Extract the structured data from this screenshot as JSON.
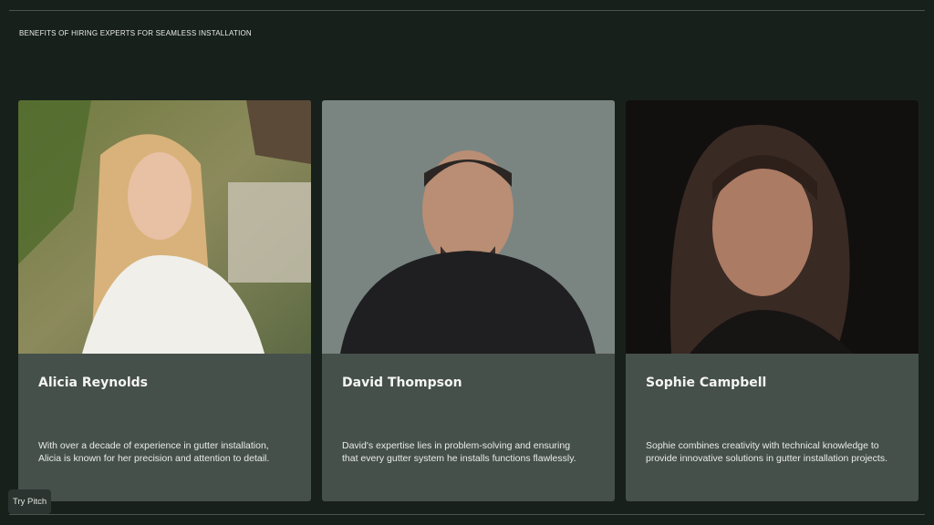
{
  "header": {
    "eyebrow": "BENEFITS OF HIRING EXPERTS FOR SEAMLESS INSTALLATION"
  },
  "team": [
    {
      "name": "Alicia Reynolds",
      "bio": "With over a decade of experience in gutter installation, Alicia is known for her precision and attention to detail."
    },
    {
      "name": "David Thompson",
      "bio": "David's expertise lies in problem-solving and ensuring that every gutter system he installs functions flawlessly."
    },
    {
      "name": "Sophie Campbell",
      "bio": "Sophie combines creativity with technical knowledge to provide innovative solutions in gutter installation projects."
    }
  ],
  "badge": {
    "label": "Try Pitch"
  },
  "colors": {
    "background": "#18201c",
    "card": "#46504a",
    "text": "#f4f5f3"
  }
}
